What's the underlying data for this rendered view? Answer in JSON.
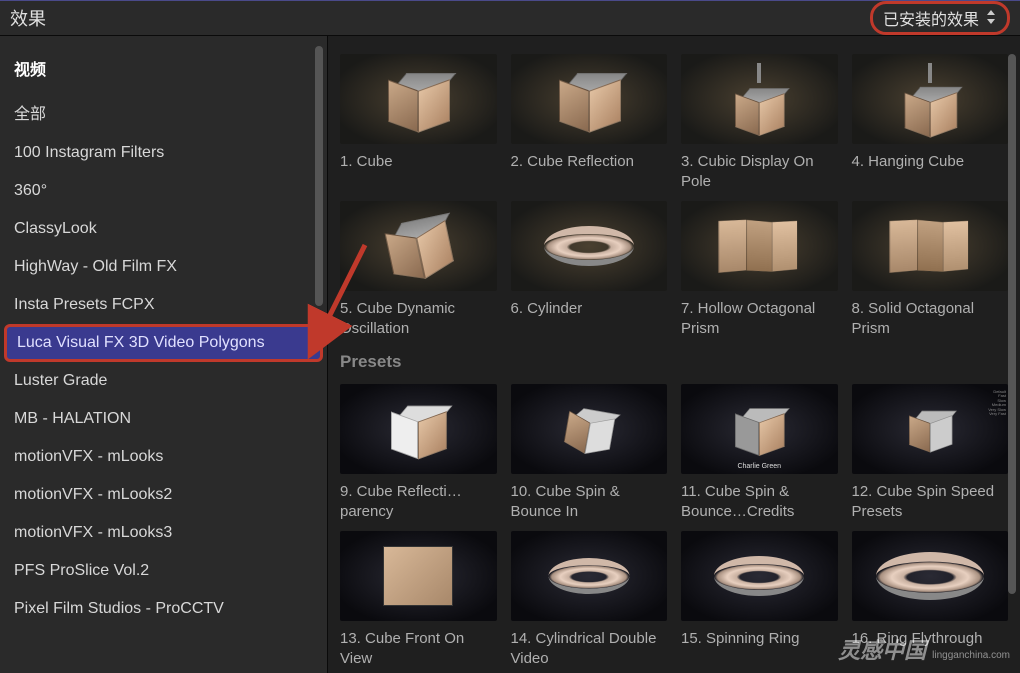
{
  "header": {
    "title": "效果",
    "dropdown_label": "已安装的效果"
  },
  "sidebar": {
    "heading": "视频",
    "items": [
      "全部",
      "100 Instagram Filters",
      "360°",
      "ClassyLook",
      "HighWay - Old Film FX",
      "Insta Presets FCPX",
      "Luca Visual FX 3D Video Polygons",
      "Luster Grade",
      "MB - HALATION",
      "motionVFX - mLooks",
      "motionVFX - mLooks2",
      "motionVFX - mLooks3",
      "PFS ProSlice Vol.2",
      "Pixel Film Studios - ProCCTV"
    ],
    "selected_index": 6
  },
  "content": {
    "row1": [
      "1. Cube",
      "2. Cube Reflection",
      "3. Cubic Display On Pole",
      "4. Hanging Cube"
    ],
    "row2": [
      "5. Cube Dynamic Oscillation",
      "6. Cylinder",
      "7. Hollow Octagonal Prism",
      "8. Solid Octagonal Prism"
    ],
    "presets_title": "Presets",
    "row3": [
      "9. Cube Reflecti…parency",
      "10. Cube Spin & Bounce In",
      "11. Cube Spin & Bounce…Credits",
      "12. Cube Spin Speed Presets"
    ],
    "row4": [
      "13. Cube Front On View",
      "14. Cylindrical Double Video",
      "15. Spinning Ring",
      "16. Ring Flythrough"
    ],
    "preset_credit": "Charlie Green"
  },
  "watermark": {
    "main": "灵感中国",
    "sub": "lingganchina.com"
  }
}
